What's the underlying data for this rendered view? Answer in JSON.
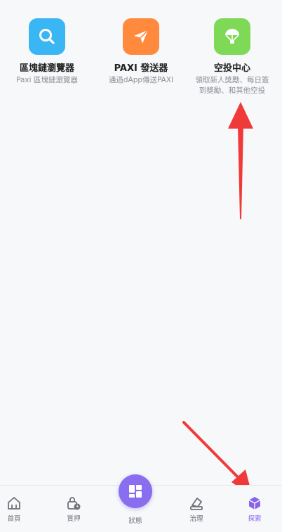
{
  "tiles": [
    {
      "title": "區塊鏈瀏覽器",
      "desc": "Paxi 區塊鏈瀏覽器",
      "icon": "search-icon",
      "color": "#3bb6f5"
    },
    {
      "title": "PAXI 發送器",
      "desc": "通過dApp傳送PAXI",
      "icon": "paper-plane-icon",
      "color": "#ff8a3d"
    },
    {
      "title": "空投中心",
      "desc": "領取新人獎勵、每日簽到獎勵、和其他空投",
      "icon": "parachute-icon",
      "color": "#7ed957"
    }
  ],
  "tabbar": {
    "home": "首頁",
    "stake": "質押",
    "status": "狀態",
    "governance": "治理",
    "explore": "探索"
  },
  "colors": {
    "accent": "#8a64e8",
    "arrow": "#f03a3a"
  }
}
